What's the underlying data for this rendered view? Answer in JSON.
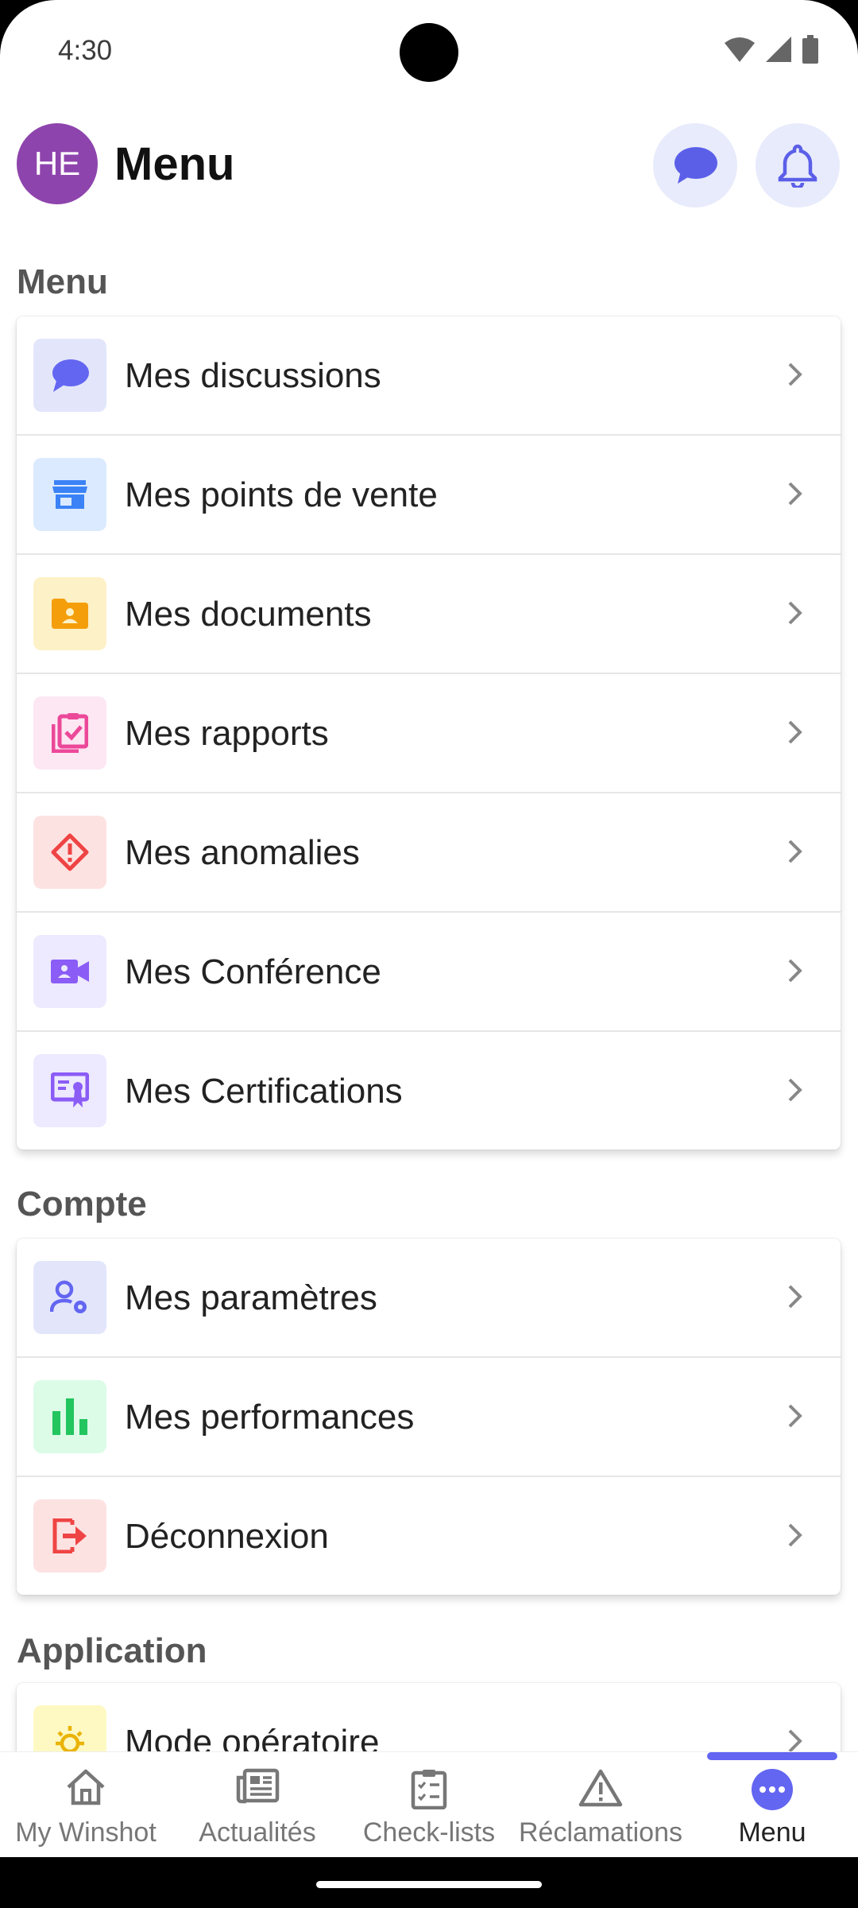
{
  "status_bar": {
    "time": "4:30"
  },
  "header": {
    "avatar_initials": "HE",
    "title": "Menu"
  },
  "sections": [
    {
      "label": "Menu",
      "items": [
        {
          "label": "Mes discussions",
          "icon": "chat-bubble-icon",
          "bg": "#e3e6fb",
          "fg": "#6366f1"
        },
        {
          "label": "Mes points de vente",
          "icon": "store-icon",
          "bg": "#dbeafe",
          "fg": "#3b82f6"
        },
        {
          "label": "Mes documents",
          "icon": "folder-user-icon",
          "bg": "#fdf1c7",
          "fg": "#f59e0b"
        },
        {
          "label": "Mes rapports",
          "icon": "clipboard-check-icon",
          "bg": "#fce7f3",
          "fg": "#ec4899"
        },
        {
          "label": "Mes anomalies",
          "icon": "warning-diamond-icon",
          "bg": "#fde2e2",
          "fg": "#ef4444"
        },
        {
          "label": "Mes Conférence",
          "icon": "video-camera-icon",
          "bg": "#ede9fe",
          "fg": "#8b5cf6"
        },
        {
          "label": "Mes Certifications",
          "icon": "certificate-icon",
          "bg": "#ede9fe",
          "fg": "#8b5cf6"
        }
      ]
    },
    {
      "label": "Compte",
      "items": [
        {
          "label": "Mes paramètres",
          "icon": "user-settings-icon",
          "bg": "#e3e6fb",
          "fg": "#6366f1"
        },
        {
          "label": "Mes performances",
          "icon": "bar-chart-icon",
          "bg": "#dcfce7",
          "fg": "#22c55e"
        },
        {
          "label": "Déconnexion",
          "icon": "logout-icon",
          "bg": "#fde2e2",
          "fg": "#ef4444"
        }
      ]
    },
    {
      "label": "Application",
      "items": [
        {
          "label": "Mode opératoire",
          "icon": "lightbulb-icon",
          "bg": "#fef9c3",
          "fg": "#eab308"
        }
      ]
    }
  ],
  "bottom_nav": [
    {
      "label": "My Winshot",
      "icon": "home-icon",
      "active": false
    },
    {
      "label": "Actualités",
      "icon": "newspaper-icon",
      "active": false
    },
    {
      "label": "Check-lists",
      "icon": "checklist-icon",
      "active": false
    },
    {
      "label": "Réclamations",
      "icon": "warning-triangle-icon",
      "active": false
    },
    {
      "label": "Menu",
      "icon": "more-circle-icon",
      "active": true
    }
  ],
  "colors": {
    "accent": "#6366f1",
    "avatar": "#8e44ad"
  }
}
